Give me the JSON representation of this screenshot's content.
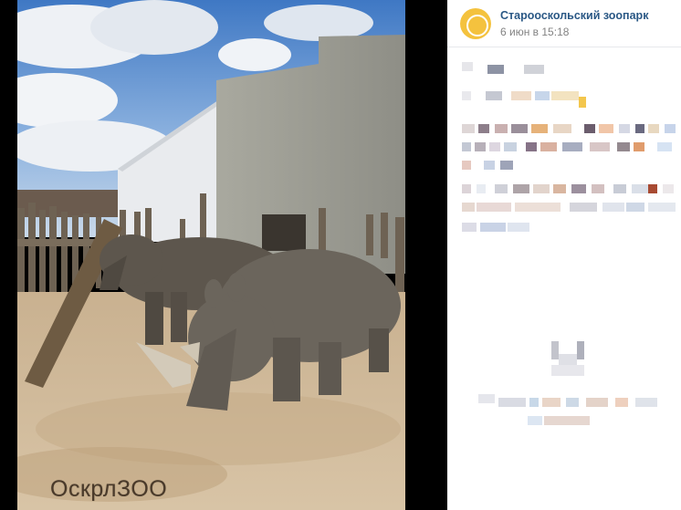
{
  "post": {
    "author": "Старооскольский зоопарк",
    "time": "6 июн в 15:18"
  },
  "photo": {
    "watermark": "ОскрлЗОО"
  },
  "colors": {
    "link": "#2a5885",
    "meta": "#828282",
    "avatar": "#f4c23e"
  }
}
